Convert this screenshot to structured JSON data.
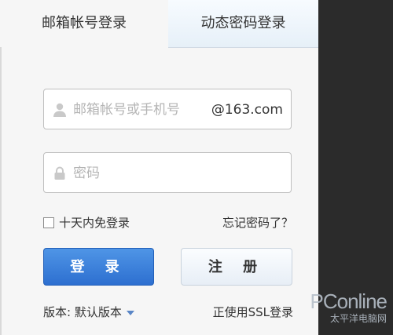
{
  "tabs": {
    "account": "邮箱帐号登录",
    "dynamic": "动态密码登录"
  },
  "username": {
    "placeholder": "邮箱帐号或手机号",
    "suffix": "@163.com"
  },
  "password": {
    "placeholder": "密码"
  },
  "remember": "十天内免登录",
  "forgot": "忘记密码了？",
  "buttons": {
    "login": "登 录",
    "register": "注 册"
  },
  "footer": {
    "version": "版本: 默认版本",
    "ssl": "正使用SSL登录"
  },
  "watermark": {
    "brand": "PConline",
    "sub": "太平洋电脑网"
  },
  "colors": {
    "primary": "#2d6fd0",
    "background": "#f6f6f6"
  }
}
